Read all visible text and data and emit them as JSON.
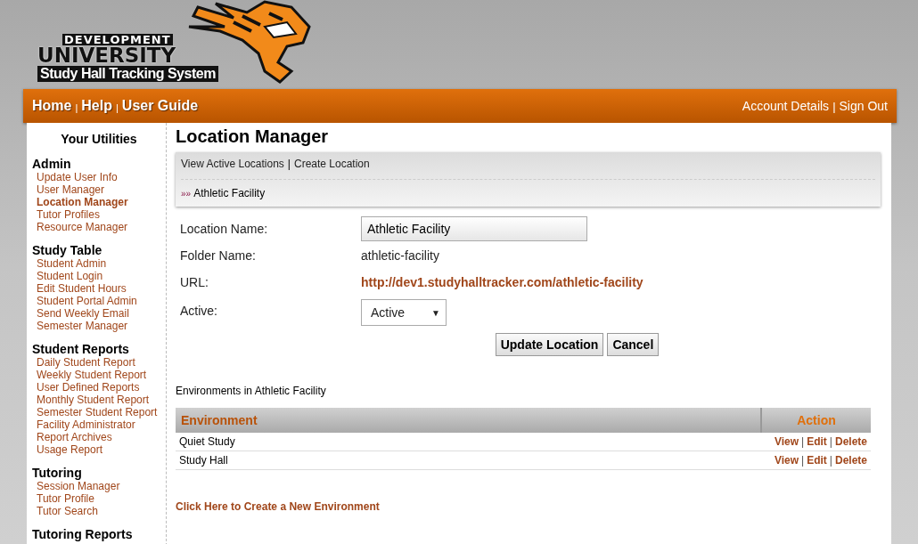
{
  "logo": {
    "line_1": "DEVELOPMENT",
    "line_2": "UNIVERSITY",
    "line_3": "Study Hall Tracking System"
  },
  "nav": {
    "separator": "|",
    "left": [
      {
        "label": "Home"
      },
      {
        "label": "Help"
      },
      {
        "label": "User Guide"
      }
    ],
    "right": [
      {
        "label": "Account Details"
      },
      {
        "label": "Sign Out"
      }
    ]
  },
  "sidebar": {
    "title": "Your Utilities",
    "sections": [
      {
        "heading": "Admin",
        "items": [
          {
            "label": "Update User Info",
            "selected": false
          },
          {
            "label": "User Manager",
            "selected": false
          },
          {
            "label": "Location Manager",
            "selected": true
          },
          {
            "label": "Tutor Profiles",
            "selected": false
          },
          {
            "label": "Resource Manager",
            "selected": false
          }
        ]
      },
      {
        "heading": "Study Table",
        "items": [
          {
            "label": "Student Admin",
            "selected": false
          },
          {
            "label": "Student Login",
            "selected": false
          },
          {
            "label": "Edit Student Hours",
            "selected": false
          },
          {
            "label": "Student Portal Admin",
            "selected": false
          },
          {
            "label": "Send Weekly Email",
            "selected": false
          },
          {
            "label": "Semester Manager",
            "selected": false
          }
        ]
      },
      {
        "heading": "Student Reports",
        "items": [
          {
            "label": "Daily Student Report",
            "selected": false
          },
          {
            "label": "Weekly Student Report",
            "selected": false
          },
          {
            "label": "User Defined Reports",
            "selected": false
          },
          {
            "label": "Monthly Student Report",
            "selected": false
          },
          {
            "label": "Semester Student Report",
            "selected": false
          },
          {
            "label": "Facility Administrator",
            "selected": false
          },
          {
            "label": "Report Archives",
            "selected": false
          },
          {
            "label": "Usage Report",
            "selected": false
          }
        ]
      },
      {
        "heading": "Tutoring",
        "items": [
          {
            "label": "Session Manager",
            "selected": false
          },
          {
            "label": "Tutor Profile",
            "selected": false
          },
          {
            "label": "Tutor Search",
            "selected": false
          }
        ]
      },
      {
        "heading": "Tutoring Reports"
      }
    ]
  },
  "page_title": "Location Manager",
  "subnav": {
    "links": [
      {
        "label": "View Active Locations"
      },
      {
        "label": "Create Location"
      }
    ],
    "separator": "|",
    "crumb_marker": "»»",
    "crumb": "Athletic Facility"
  },
  "form": {
    "location_name": {
      "label": "Location Name:",
      "value": "Athletic Facility"
    },
    "folder_name": {
      "label": "Folder Name:",
      "value": "athletic-facility"
    },
    "url": {
      "label": "URL:",
      "value": "http://dev1.studyhalltracker.com/athletic-facility"
    },
    "active": {
      "label": "Active:",
      "value": "Active",
      "arrow": "▼"
    },
    "buttons": [
      "Update Location",
      "Cancel"
    ]
  },
  "environments": {
    "caption": "Environments in Athletic Facility",
    "columns": [
      "Environment",
      "Action"
    ],
    "rows": [
      {
        "name": "Quiet Study",
        "actions": [
          "View",
          "Edit",
          "Delete"
        ]
      },
      {
        "name": "Study Hall",
        "actions": [
          "View",
          "Edit",
          "Delete"
        ]
      }
    ],
    "action_separator": "|"
  },
  "create_link": "Click Here to Create a New Environment"
}
